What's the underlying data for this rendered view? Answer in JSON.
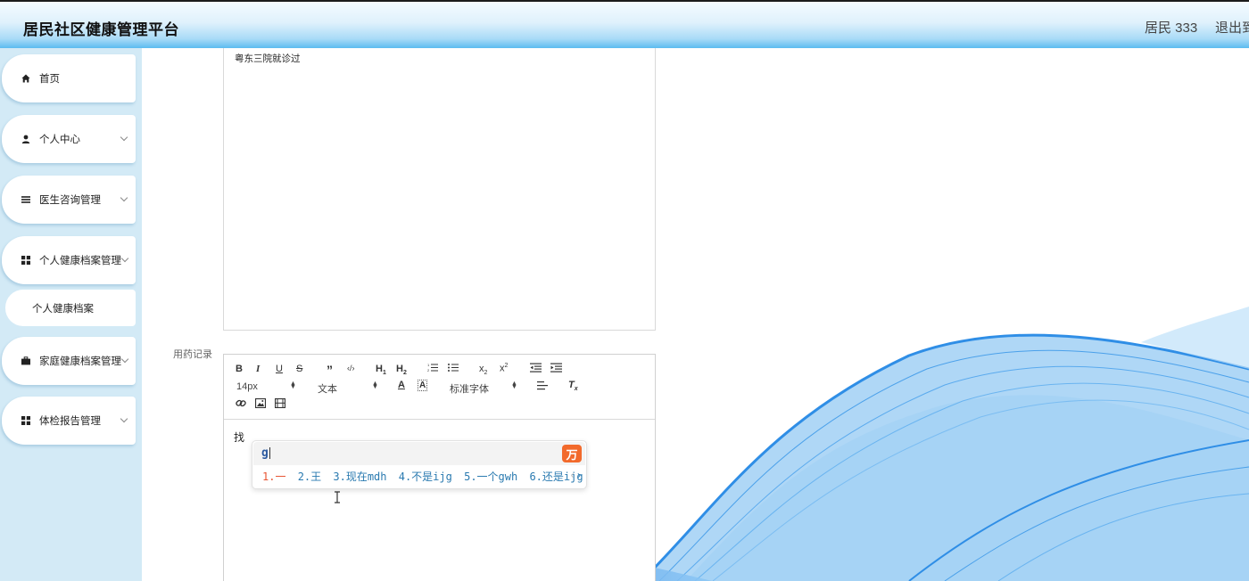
{
  "header": {
    "title": "居民社区健康管理平台",
    "user": "居民 333",
    "logout": "退出到"
  },
  "sidebar": {
    "items": [
      {
        "label": "首页",
        "icon": "home-icon"
      },
      {
        "label": "个人中心",
        "icon": "user-icon"
      },
      {
        "label": "医生咨询管理",
        "icon": "list-icon"
      },
      {
        "label": "个人健康档案管理",
        "icon": "grid-icon"
      },
      {
        "label": "家庭健康档案管理",
        "icon": "briefcase-icon"
      },
      {
        "label": "体检报告管理",
        "icon": "grid-icon"
      }
    ],
    "active_sub": "个人健康档案"
  },
  "form": {
    "prev_field_text": "粤东三院就诊过",
    "med_label": "用药记录",
    "editor": {
      "size_select": "14px",
      "format_select": "文本",
      "font_select": "标准字体",
      "content": "找"
    }
  },
  "ime": {
    "input": "g",
    "logo": "万",
    "candidates": [
      "1.一",
      "2.王",
      "3.现在mdh",
      "4.不是ijg",
      "5.一个gwh",
      "6.还是ijg"
    ],
    "prev": "‹",
    "next": "›"
  },
  "colors": {
    "accent": "#5bbbf0",
    "sidebar_bg": "#d3eaf6",
    "wave": "#2f8ee6"
  }
}
